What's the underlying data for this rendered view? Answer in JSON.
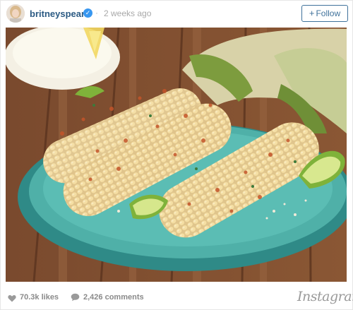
{
  "post": {
    "username": "britneyspears",
    "separator": "·",
    "time_ago": "2 weeks ago",
    "follow_label": "Follow",
    "follow_plus": "+"
  },
  "stats": {
    "likes": "70.3k likes",
    "comments": "2,426 comments"
  },
  "brand": {
    "logo_text": "Instagram"
  },
  "colors": {
    "username": "#2b5a83",
    "follow_border": "#3f729b",
    "verified": "#3897f0",
    "meta_text": "#8a8a8a"
  },
  "icons": {
    "verified": "verified-badge-icon",
    "likes": "heart-icon",
    "comments": "speech-bubble-icon"
  }
}
